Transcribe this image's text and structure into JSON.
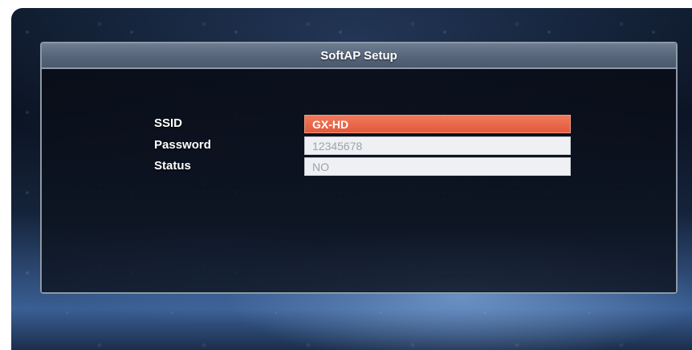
{
  "dialog": {
    "title": "SoftAP Setup"
  },
  "settings": [
    {
      "label": "SSID",
      "value": "GX-HD",
      "selected": true
    },
    {
      "label": "Password",
      "value": "12345678",
      "selected": false
    },
    {
      "label": "Status",
      "value": "NO",
      "selected": false
    }
  ],
  "colors": {
    "highlight": "#e8654a",
    "field_background": "#eef0f3",
    "title_bar": "#5f6e82"
  }
}
